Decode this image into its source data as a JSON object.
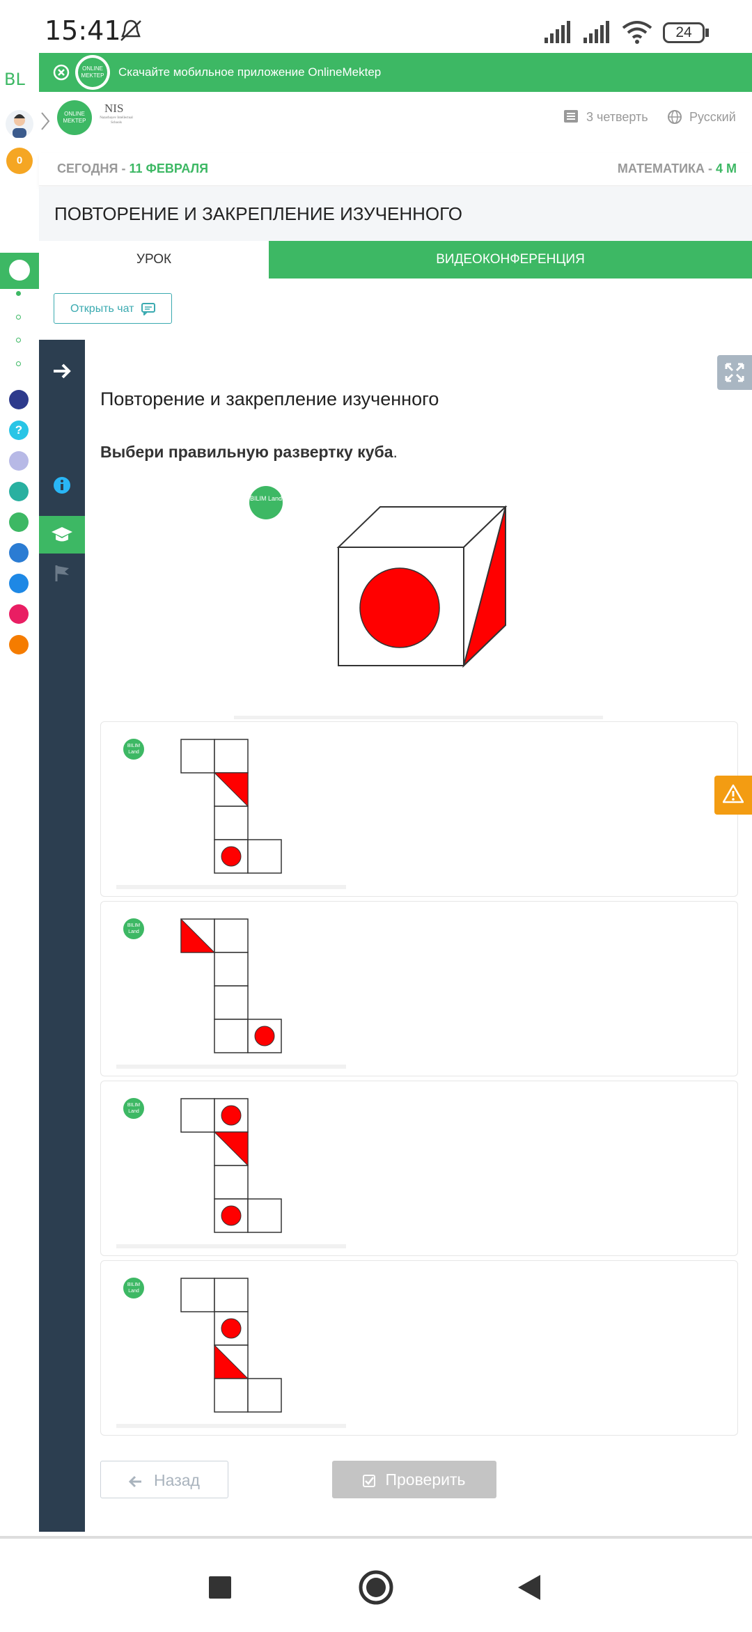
{
  "status": {
    "time": "15:41",
    "battery": "24"
  },
  "rail": {
    "brand": "BL",
    "coins": "0"
  },
  "banner": {
    "text": "Скачайте мобильное приложение OnlineMektep"
  },
  "header": {
    "logo_text": "ONLINE MEKTEP",
    "nis_text": "NIS",
    "nis_sub": "Nazarbayev Intellectual Schools",
    "quarter": "3 четверть",
    "language": "Русский"
  },
  "subheader": {
    "today_label": "СЕГОДНЯ - ",
    "today_date": "11 ФЕВРАЛЯ",
    "subject_label": "МАТЕМАТИКА - ",
    "subject_grade": "4 М"
  },
  "page_title": "ПОВТОРЕНИЕ И ЗАКРЕПЛЕНИЕ ИЗУЧЕННОГО",
  "tabs": [
    {
      "label": "УРОК",
      "active": true
    },
    {
      "label": "ВИДЕОКОНФЕРЕНЦИЯ",
      "active": false
    }
  ],
  "chat_button": "Открыть чат",
  "lesson": {
    "heading": "Повторение и закрепление изученного",
    "question": "Выбери правильную развертку куба",
    "question_end": "."
  },
  "bilim_logo": "BILIM Land",
  "footer": {
    "back": "Назад",
    "check": "Проверить"
  },
  "colors": {
    "green": "#3db864",
    "dark": "#2c3e50",
    "red": "#ff0000"
  }
}
